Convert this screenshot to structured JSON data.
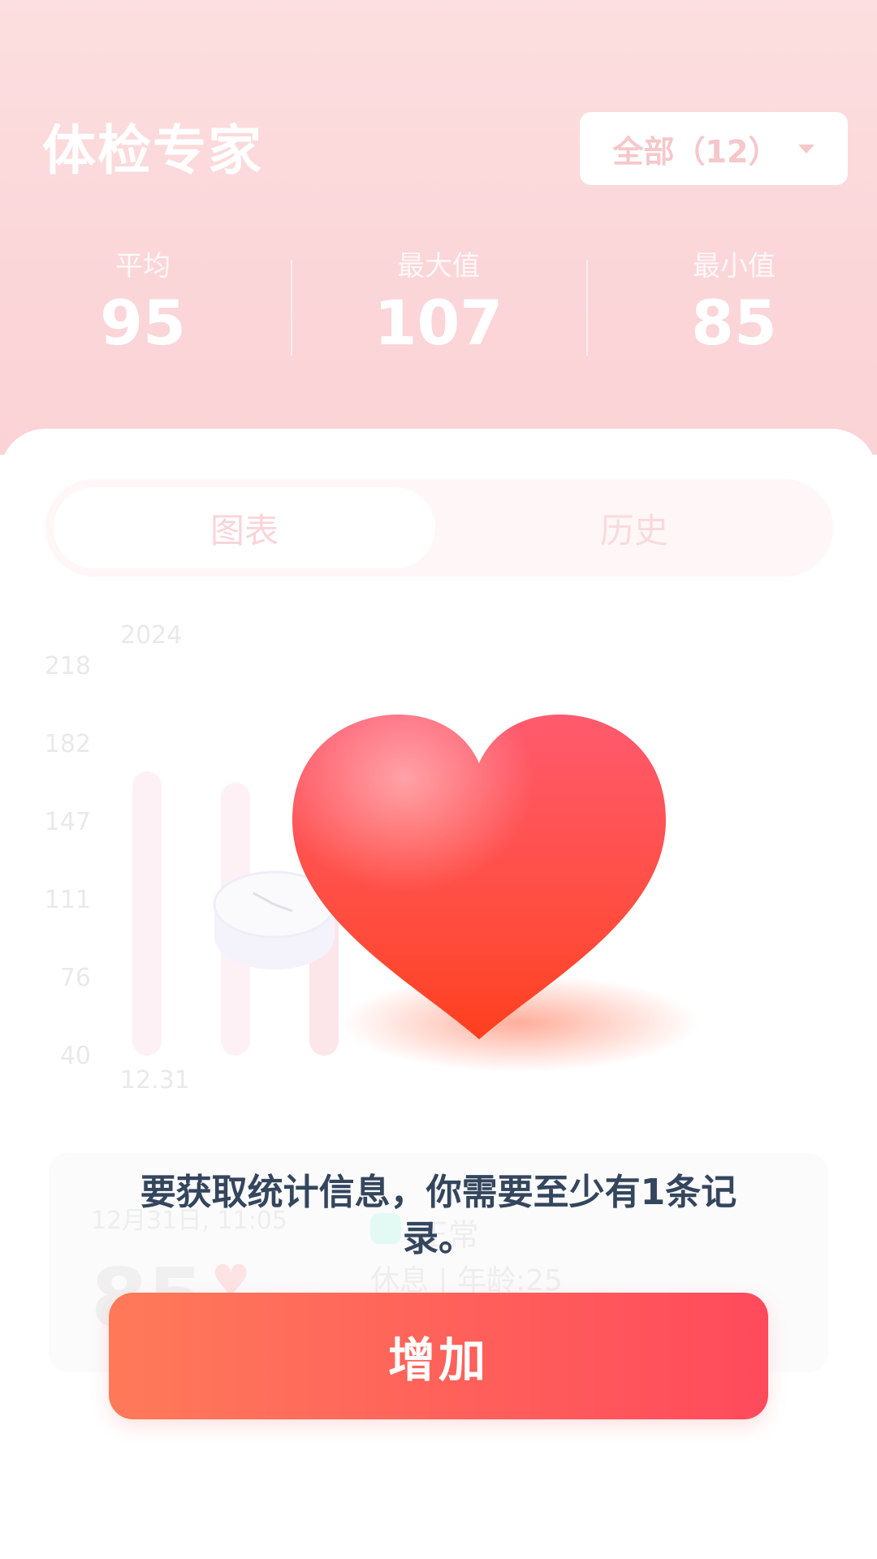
{
  "header": {
    "title": "体检专家",
    "filter_label": "全部（12）"
  },
  "stats": [
    {
      "label": "平均",
      "value": "95"
    },
    {
      "label": "最大值",
      "value": "107"
    },
    {
      "label": "最小值",
      "value": "85"
    }
  ],
  "tabs": [
    {
      "label": "图表",
      "active": true
    },
    {
      "label": "历史",
      "active": false
    }
  ],
  "chart_data": {
    "type": "bar",
    "year_label": "2024",
    "y_ticks": [
      "218",
      "182",
      "147",
      "111",
      "76",
      "40"
    ],
    "ylim": [
      40,
      218
    ],
    "categories": [
      "12.31"
    ]
  },
  "record": {
    "date": "12月31日, 11:05",
    "value": "85",
    "status": "正常",
    "meta": "休息 | 年龄:25"
  },
  "overlay": {
    "message": "要获取统计信息，你需要至少有1条记录。",
    "add_button": "增加"
  },
  "colors": {
    "header_bg": "#fbd6d9",
    "accent_start": "#ff7a59",
    "accent_end": "#ff4a5c",
    "message_text": "#34465e"
  }
}
